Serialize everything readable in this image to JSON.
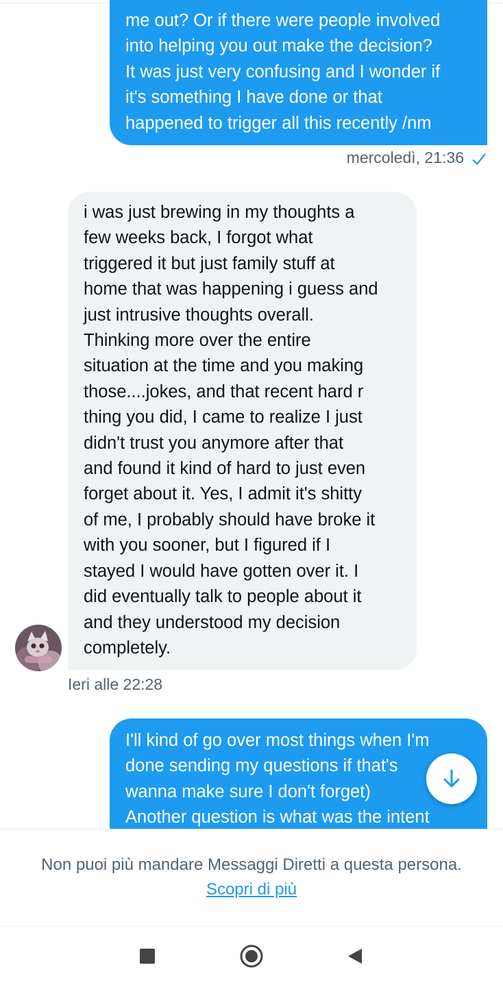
{
  "messages": [
    {
      "direction": "sent",
      "lines": [
        "me out? Or if there were people involved",
        "into helping you out make the decision?",
        "It was just very confusing and I wonder if",
        "it's something I have done or that",
        "happened to trigger all this recently /nm"
      ],
      "timestamp": "mercoledì, 21:36",
      "read_icon": "checkmark-icon"
    },
    {
      "direction": "received",
      "lines": [
        "i was just brewing in my thoughts a",
        "few weeks back, I forgot what",
        "triggered it but just family stuff at",
        "home that was happening i guess and",
        "just intrusive thoughts overall.",
        "Thinking more over the entire",
        "situation at the time and you making",
        "those....jokes, and that recent hard r",
        "thing you did, I came to realize I just",
        "didn't trust you anymore after that",
        "and found it kind of hard to just even",
        "forget about it. Yes, I admit it's shitty",
        "of me, I probably should have broke it",
        "with you sooner, but I figured if I",
        "stayed I would have gotten over it. I",
        "did eventually talk to people about it",
        "and they understood my decision",
        "completely."
      ],
      "timestamp": "Ieri alle 22:28",
      "avatar": "cat-avatar"
    },
    {
      "direction": "sent",
      "lines": [
        "I'll kind of go over most things when I'm",
        "done sending my questions if that's",
        "wanna make sure I don't forget)",
        "Another question is what was the intent"
      ]
    }
  ],
  "scroll_button_icon": "arrow-down-icon",
  "footer": {
    "notice": "Non puoi più mandare Messaggi Diretti a questa persona.",
    "link": "Scopri di più"
  },
  "nav": {
    "recent_icon": "square-icon",
    "home_icon": "circle-icon",
    "back_icon": "triangle-back-icon"
  },
  "colors": {
    "sent_bubble": "#1d9bf0",
    "received_bubble": "#eff3f4",
    "meta_text": "#536471",
    "link": "#1d9bf0"
  }
}
